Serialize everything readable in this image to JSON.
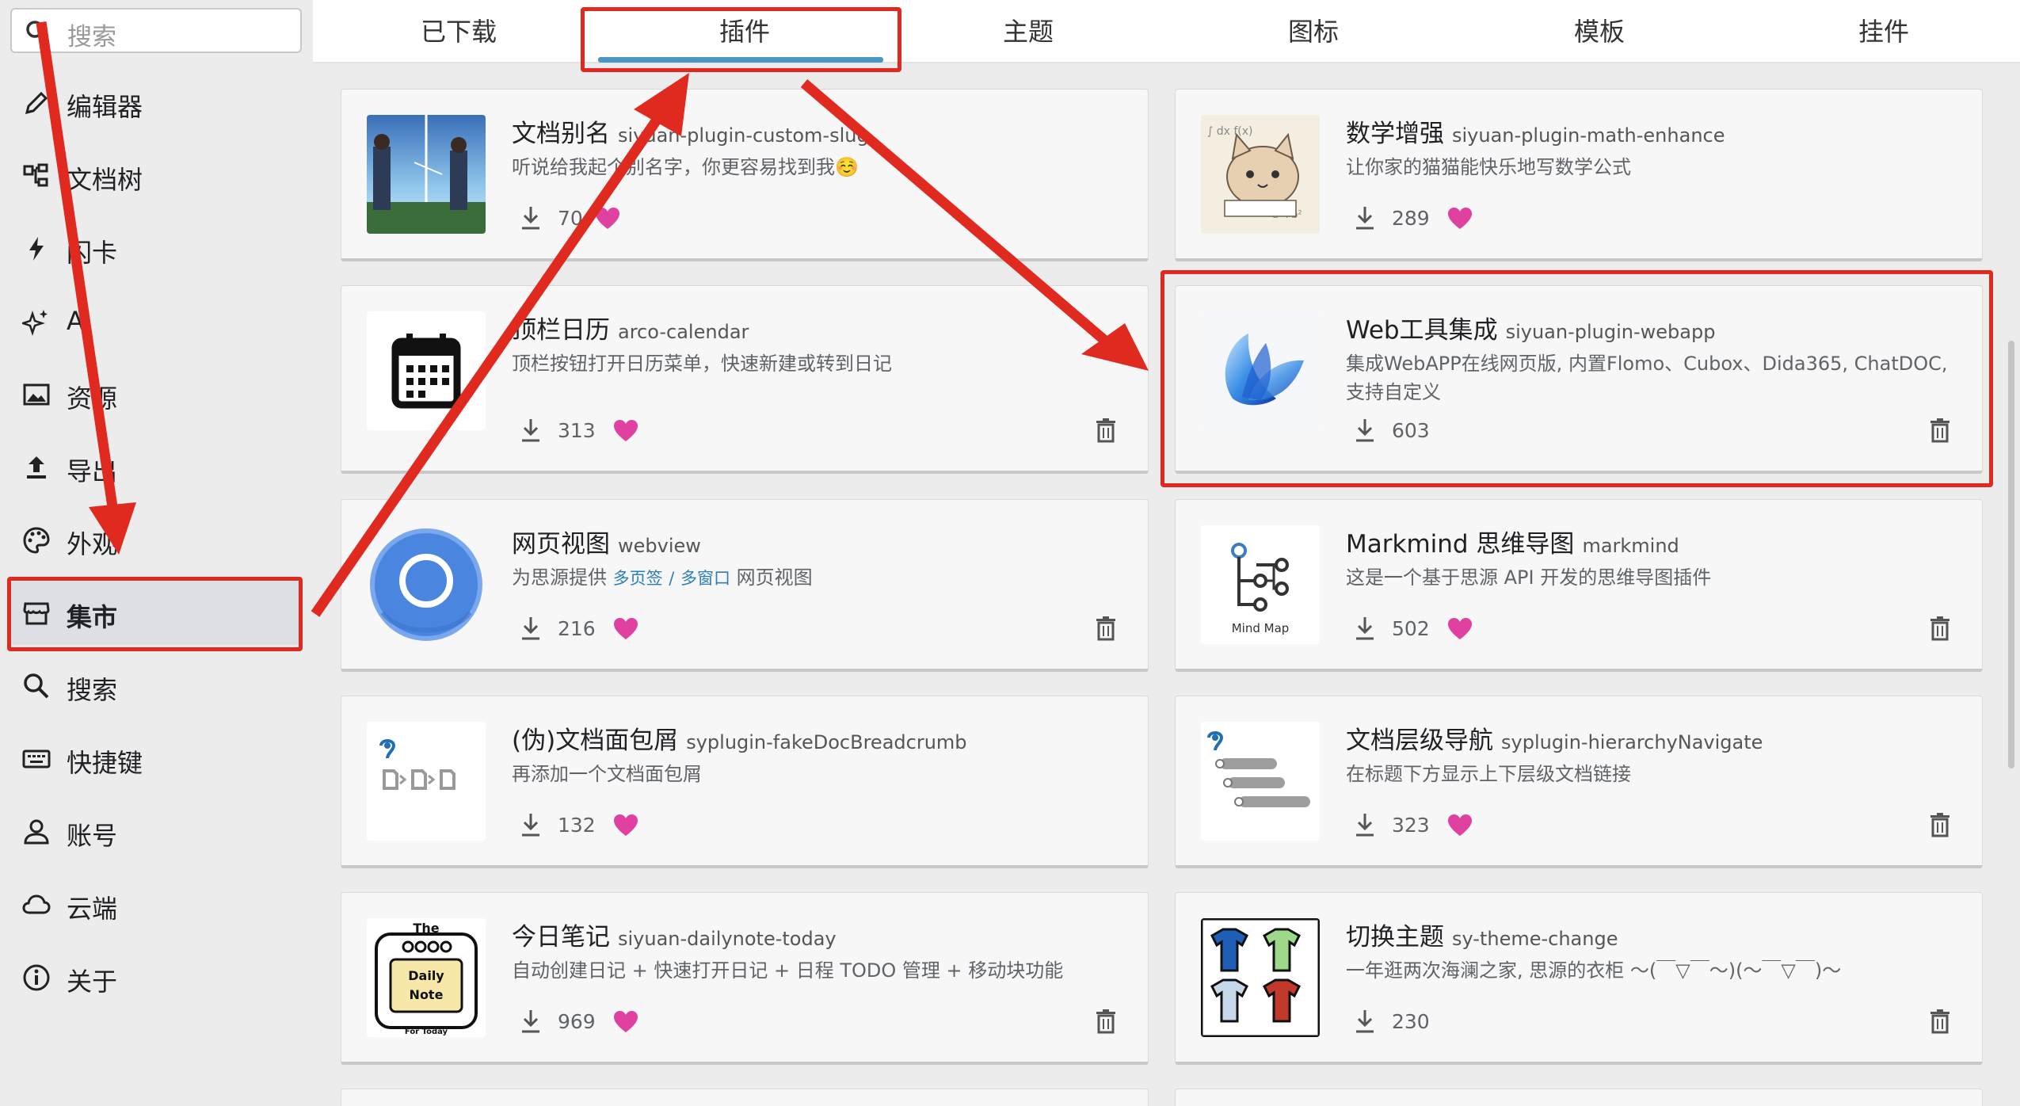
{
  "search": {
    "placeholder": "搜索"
  },
  "sidebar": {
    "items": [
      {
        "label": "编辑器",
        "icon": "pencil-icon"
      },
      {
        "label": "文档树",
        "icon": "tree-icon"
      },
      {
        "label": "闪卡",
        "icon": "flash-icon"
      },
      {
        "label": "AI",
        "icon": "sparkle-icon"
      },
      {
        "label": "资源",
        "icon": "image-icon"
      },
      {
        "label": "导出",
        "icon": "upload-icon"
      },
      {
        "label": "外观",
        "icon": "palette-icon"
      },
      {
        "label": "集市",
        "icon": "store-icon",
        "active": true
      },
      {
        "label": "搜索",
        "icon": "search-icon"
      },
      {
        "label": "快捷键",
        "icon": "keyboard-icon"
      },
      {
        "label": "账号",
        "icon": "user-icon"
      },
      {
        "label": "云端",
        "icon": "cloud-icon"
      },
      {
        "label": "关于",
        "icon": "info-icon"
      }
    ]
  },
  "tabs": [
    {
      "label": "已下载"
    },
    {
      "label": "插件",
      "active": true
    },
    {
      "label": "主题"
    },
    {
      "label": "图标"
    },
    {
      "label": "模板"
    },
    {
      "label": "挂件"
    }
  ],
  "plugins": [
    {
      "name": "文档别名",
      "pkg": "siyuan-plugin-custom-slug",
      "desc": "听说给我起个别名字，你更容易找到我☺️",
      "downloads": "70",
      "thumb": "anime-photo"
    },
    {
      "name": "数学增强",
      "pkg": "siyuan-plugin-math-enhance",
      "desc": "让你家的猫猫能快乐地写数学公式",
      "downloads": "289",
      "thumb": "cat-drawing"
    },
    {
      "name": "顶栏日历",
      "pkg": "arco-calendar",
      "desc": "顶栏按钮打开日历菜单，快速新建或转到日记",
      "downloads": "313",
      "thumb": "calendar-icon"
    },
    {
      "name": "Web工具集成",
      "pkg": "siyuan-plugin-webapp",
      "desc": "集成WebAPP在线网页版, 内置Flomo、Cubox、Dida365, ChatDOC, 支持自定义",
      "downloads": "603",
      "thumb": "blue-flower-logo"
    },
    {
      "name": "网页视图",
      "pkg": "webview",
      "desc_prefix": "为思源提供",
      "desc_tag1": "多页签",
      "desc_sep": "/",
      "desc_tag2": "多窗口",
      "desc_suffix": "网页视图",
      "downloads": "216",
      "thumb": "chrome-logo"
    },
    {
      "name": "Markmind 思维导图",
      "pkg": "markmind",
      "desc": "这是一个基于思源 API 开发的思维导图插件",
      "downloads": "502",
      "thumb": "mindmap-logo",
      "thumb_text": "Mind Map"
    },
    {
      "name": "(伪)文档面包屑",
      "pkg": "syplugin-fakeDocBreadcrumb",
      "desc": "再添加一个文档面包屑",
      "downloads": "132",
      "thumb": "breadcrumb-logo"
    },
    {
      "name": "文档层级导航",
      "pkg": "syplugin-hierarchyNavigate",
      "desc": "在标题下方显示上下层级文档链接",
      "downloads": "323",
      "thumb": "hierarchy-logo"
    },
    {
      "name": "今日笔记",
      "pkg": "siyuan-dailynote-today",
      "desc": "自动创建日记 + 快速打开日记 + 日程 TODO 管理 + 移动块功能",
      "downloads": "969",
      "thumb": "daily-note-logo",
      "thumb_text_1": "The",
      "thumb_text_2": "Daily",
      "thumb_text_3": "Note",
      "thumb_text_4": "For Today"
    },
    {
      "name": "切换主题",
      "pkg": "sy-theme-change",
      "desc": "一年逛两次海澜之家, 思源的衣柜 ～(￣▽￣～)(～￣▽￣)～",
      "downloads": "230",
      "thumb": "tshirts-logo"
    }
  ],
  "colors": {
    "accent": "#4a96c4",
    "annotation": "#e0291f",
    "heart": "#e040a0"
  }
}
